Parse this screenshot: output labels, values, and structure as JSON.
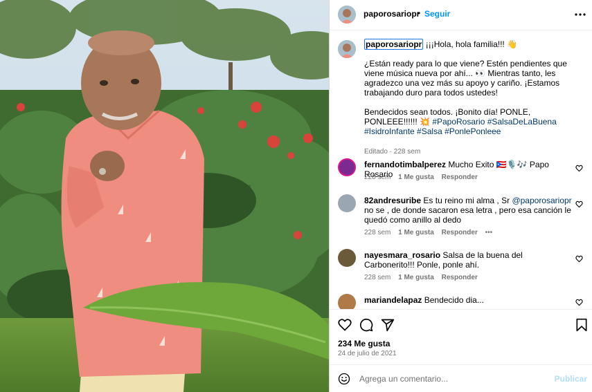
{
  "header": {
    "username": "paporosariopr",
    "separator": "•",
    "follow_label": "Seguir"
  },
  "caption": {
    "username": "paporosariopr",
    "line1": "¡¡¡Hola, hola familia!!! 👋",
    "para2": "¿Están ready para lo que viene? Estén pendientes que viene música nueva por ahí... 👀 Mientras tanto, les agradezco una vez más su apoyo y cariño. ¡Estamos trabajando duro para todos ustedes!",
    "para3_text": "Bendecidos sean todos. ¡Bonito día! PONLE, PONLEEE!!!!!! 💥",
    "hashtags": "#PapoRosario #SalsaDeLaBuena #IsidroInfante #Salsa #PonlePonleee",
    "meta": "Editado · 228 sem"
  },
  "comments": [
    {
      "username": "fernandotimbalperez",
      "text": "Mucho Exito 🇵🇷🎙️🎶 Papo Rosario",
      "time": "228 sem",
      "likes": "1 Me gusta",
      "reply": "Responder",
      "avatar_color": "#7b2b8f"
    },
    {
      "username": "82andresuribe",
      "text_before": "Es tu reino mi alma , Sr ",
      "mention": "@paporosariopr",
      "text_after": " no se , de donde sacaron esa letra , pero esa canción le quedó como anillo al dedo",
      "time": "228 sem",
      "likes": "1 Me gusta",
      "reply": "Responder",
      "more": "•••",
      "avatar_color": "#9aa6b2"
    },
    {
      "username": "nayesmara_rosario",
      "text": "Salsa de la buena del Carbonerito!!! Ponle, ponle ahí.",
      "time": "228 sem",
      "likes": "1 Me gusta",
      "reply": "Responder",
      "avatar_color": "#6b5a3a"
    },
    {
      "username": "mariandelapaz",
      "text": "Bendecido dia...",
      "avatar_color": "#b07a48"
    }
  ],
  "actions": {
    "likes": "234 Me gusta",
    "date": "24 de julio de 2021"
  },
  "composer": {
    "placeholder": "Agrega un comentario...",
    "publish_label": "Publicar"
  },
  "icons": [
    "more-icon",
    "heart-icon",
    "comment-icon",
    "share-icon",
    "save-icon",
    "emoji-icon"
  ],
  "colors": {
    "accent": "#0095f6",
    "link": "#00376b",
    "secondary_text": "#737373",
    "shirt": "#ef8d80"
  }
}
